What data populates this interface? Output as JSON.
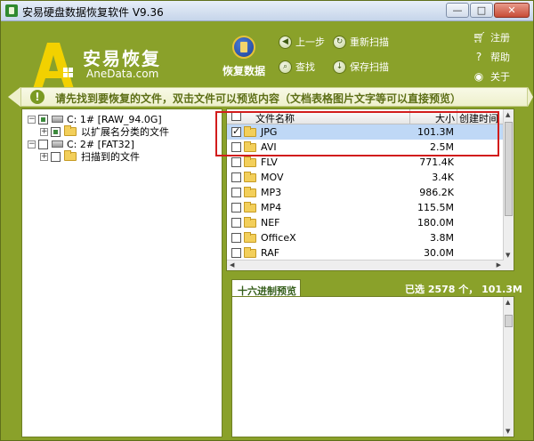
{
  "window": {
    "title": "安易硬盘数据恢复软件 V9.36",
    "buttons": {
      "minimize": "—",
      "maximize": "□",
      "close": "✕"
    }
  },
  "header": {
    "logo_title": "安易恢复",
    "logo_sub": "AneData.com",
    "recover_label": "恢复数据",
    "back_label": "上一步",
    "rescan_label": "重新扫描",
    "find_label": "查找",
    "save_scan_label": "保存扫描",
    "register_label": "注册",
    "help_label": "帮助",
    "about_label": "关于"
  },
  "info": {
    "message": "请先找到要恢复的文件，双击文件可以预览内容（文档表格图片文字等可以直接预览）"
  },
  "tree": {
    "items": [
      {
        "label": "C:  1# [RAW_94.0G]"
      },
      {
        "label": "以扩展名分类的文件"
      },
      {
        "label": "C:  2# [FAT32]"
      },
      {
        "label": "扫描到的文件"
      }
    ]
  },
  "file_list": {
    "columns": {
      "name": "文件名称",
      "size": "大小",
      "time": "创建时间"
    },
    "rows": [
      {
        "name": "JPG",
        "size": "101.3M"
      },
      {
        "name": "AVI",
        "size": "2.5M"
      },
      {
        "name": "FLV",
        "size": "771.4K"
      },
      {
        "name": "MOV",
        "size": "3.4K"
      },
      {
        "name": "MP3",
        "size": "986.2K"
      },
      {
        "name": "MP4",
        "size": "115.5M"
      },
      {
        "name": "NEF",
        "size": "180.0M"
      },
      {
        "name": "OfficeX",
        "size": "3.8M"
      },
      {
        "name": "RAF",
        "size": "30.0M"
      }
    ]
  },
  "preview": {
    "tab_label": "十六进制预览",
    "selection_summary": "已选 2578 个， 101.3M"
  },
  "colors": {
    "frame_green": "#8aa12a",
    "selection_blue": "#bfd8f6",
    "highlight_red": "#d21c1c"
  }
}
